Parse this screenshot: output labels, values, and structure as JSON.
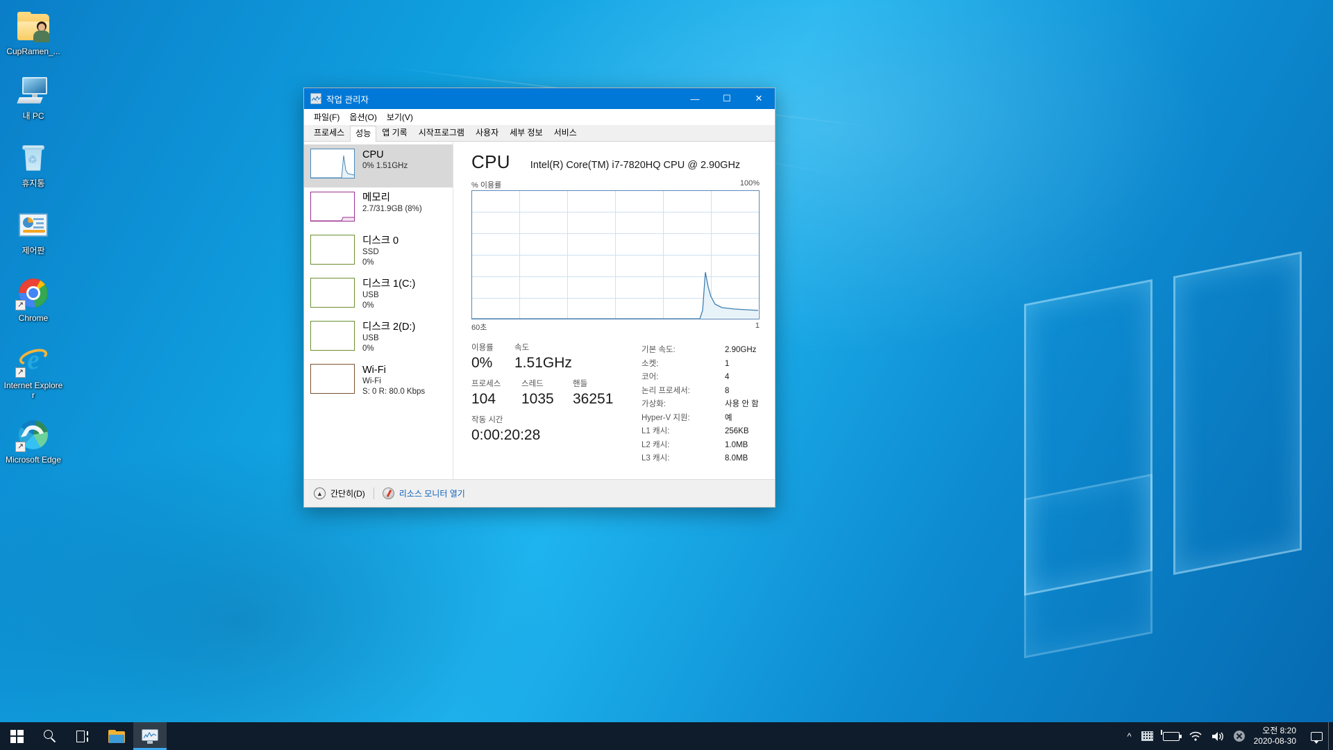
{
  "desktop": {
    "icons": [
      {
        "label": "CupRamen_...",
        "icon": "folder-user-icon",
        "shortcut": false
      },
      {
        "label": "내 PC",
        "icon": "this-pc-icon",
        "shortcut": false
      },
      {
        "label": "휴지통",
        "icon": "recycle-bin-icon",
        "shortcut": false
      },
      {
        "label": "제어판",
        "icon": "control-panel-icon",
        "shortcut": false
      },
      {
        "label": "Chrome",
        "icon": "chrome-icon",
        "shortcut": true
      },
      {
        "label": "Internet Explorer",
        "icon": "internet-explorer-icon",
        "shortcut": true
      },
      {
        "label": "Microsoft Edge",
        "icon": "microsoft-edge-icon",
        "shortcut": true
      }
    ]
  },
  "window": {
    "title": "작업 관리자",
    "icon": "task-manager-icon",
    "controls": {
      "minimize": "—",
      "maximize": "☐",
      "close": "✕"
    },
    "menu": [
      "파일(F)",
      "옵션(O)",
      "보기(V)"
    ],
    "tabs": [
      {
        "label": "프로세스",
        "active": false
      },
      {
        "label": "성능",
        "active": true
      },
      {
        "label": "앱 기록",
        "active": false
      },
      {
        "label": "시작프로그램",
        "active": false
      },
      {
        "label": "사용자",
        "active": false
      },
      {
        "label": "세부 정보",
        "active": false
      },
      {
        "label": "서비스",
        "active": false
      }
    ]
  },
  "sidebar": {
    "items": [
      {
        "name": "CPU",
        "sub1": "0% 1.51GHz",
        "sub2": "",
        "color": "#4a89b8",
        "selected": true,
        "spike": "cpu"
      },
      {
        "name": "메모리",
        "sub1": "2.7/31.9GB (8%)",
        "sub2": "",
        "color": "#9b2f8f",
        "selected": false,
        "spike": "mem"
      },
      {
        "name": "디스크 0",
        "sub1": "SSD",
        "sub2": "0%",
        "color": "#6b8f2f",
        "selected": false,
        "spike": "flat"
      },
      {
        "name": "디스크 1(C:)",
        "sub1": "USB",
        "sub2": "0%",
        "color": "#6b8f2f",
        "selected": false,
        "spike": "flat"
      },
      {
        "name": "디스크 2(D:)",
        "sub1": "USB",
        "sub2": "0%",
        "color": "#6b8f2f",
        "selected": false,
        "spike": "flat"
      },
      {
        "name": "Wi-Fi",
        "sub1": "Wi-Fi",
        "sub2": "S: 0 R: 80.0 Kbps",
        "color": "#7a5230",
        "selected": false,
        "spike": "flat"
      }
    ]
  },
  "main": {
    "title": "CPU",
    "subtitle": "Intel(R) Core(TM) i7-7820HQ CPU @ 2.90GHz",
    "graph": {
      "y_label": "% 이용률",
      "y_max": "100%",
      "x_left": "60초",
      "x_right": "1",
      "line_color": "#4a89b8",
      "fill_color": "#e8f2f9"
    },
    "stats": [
      {
        "label": "이용률",
        "value": "0%"
      },
      {
        "label": "속도",
        "value": "1.51GHz"
      },
      {
        "label": "프로세스",
        "value": "104"
      },
      {
        "label": "스레드",
        "value": "1035"
      },
      {
        "label": "핸들",
        "value": "36251"
      },
      {
        "label": "작동 시간",
        "value": "0:00:20:28"
      }
    ],
    "details": [
      {
        "key": "기본 속도:",
        "value": "2.90GHz"
      },
      {
        "key": "소켓:",
        "value": "1"
      },
      {
        "key": "코어:",
        "value": "4"
      },
      {
        "key": "논리 프로세서:",
        "value": "8"
      },
      {
        "key": "가상화:",
        "value": "사용 안 함"
      },
      {
        "key": "Hyper-V 지원:",
        "value": "예"
      },
      {
        "key": "L1 캐시:",
        "value": "256KB"
      },
      {
        "key": "L2 캐시:",
        "value": "1.0MB"
      },
      {
        "key": "L3 캐시:",
        "value": "8.0MB"
      }
    ]
  },
  "footer": {
    "collapse_label": "간단히(D)",
    "resmon_label": "리소스 모니터 열기"
  },
  "taskbar": {
    "buttons": [
      {
        "name": "start-button",
        "icon": "windows-logo-icon"
      },
      {
        "name": "search-button",
        "icon": "search-icon"
      },
      {
        "name": "task-view-button",
        "icon": "task-view-icon"
      },
      {
        "name": "file-explorer-button",
        "icon": "folder-icon"
      },
      {
        "name": "task-manager-button",
        "icon": "task-manager-icon"
      }
    ],
    "tray": {
      "chevron": "^",
      "icons": [
        "keyboard-icon",
        "battery-icon",
        "wifi-icon",
        "volume-icon",
        "error-badge-icon"
      ],
      "time": "오전 8:20",
      "date": "2020-08-30",
      "notification": "notification-icon"
    }
  },
  "chart_data": {
    "type": "area",
    "title": "% 이용률",
    "xlabel": "60초 → 1",
    "ylabel": "% 이용률",
    "ylim": [
      0,
      100
    ],
    "xlim": [
      0,
      60
    ],
    "grid": true,
    "legend": "none",
    "series": [
      {
        "name": "CPU 이용률",
        "x": [
          0,
          38,
          42,
          44,
          46,
          48,
          50,
          52,
          54,
          56,
          58,
          60
        ],
        "values": [
          0,
          0,
          2,
          38,
          20,
          11,
          8,
          7,
          6,
          5,
          2,
          1
        ]
      }
    ]
  }
}
